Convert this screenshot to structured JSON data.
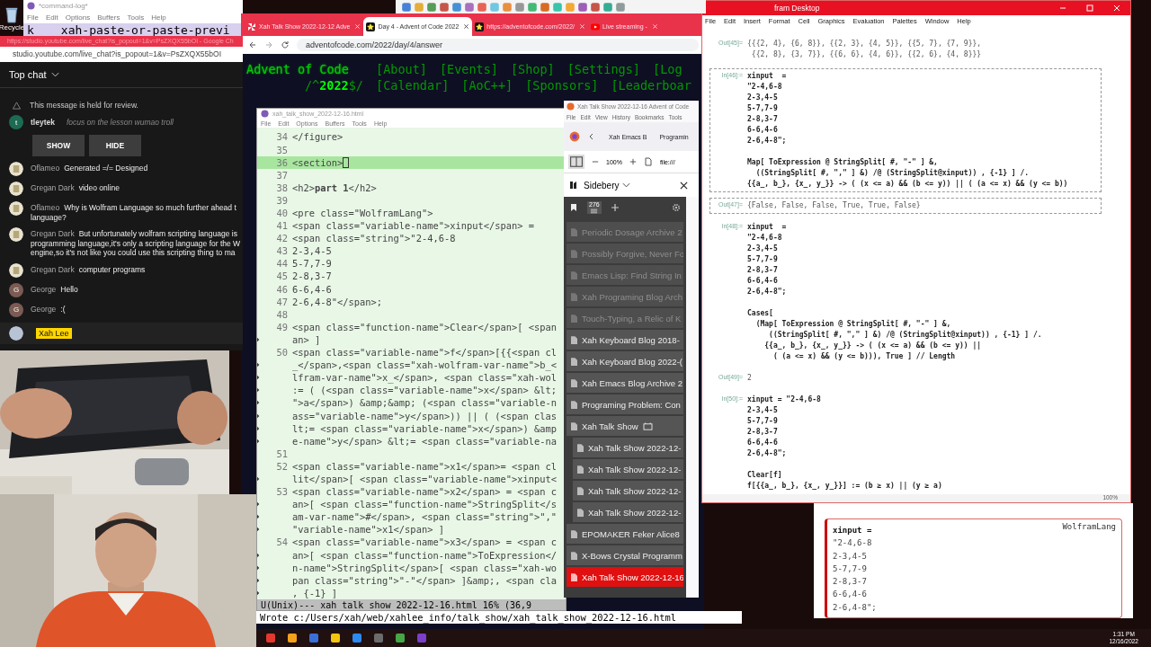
{
  "desktop": {
    "recycle_label": "Recycle"
  },
  "command_log": {
    "title": "*command-log*",
    "menu": [
      "File",
      "Edit",
      "Options",
      "Buffers",
      "Tools",
      "Help"
    ],
    "key": "k",
    "command": "xah-paste-or-paste-previ"
  },
  "chrome": {
    "tabs": [
      {
        "label": "Xah Talk Show 2022-12-12 Adve",
        "selected": false
      },
      {
        "label": "Day 4 - Advent of Code 2022",
        "selected": true
      },
      {
        "label": "https://adventofcode.com/2022/",
        "selected": false
      },
      {
        "label": "Live streaming - ",
        "selected": false
      }
    ],
    "url": "adventofcode.com/2022/day/4/answer",
    "site_title": "Advent of Code",
    "year_prefix": "/^",
    "year": "2022",
    "year_suffix": "$/",
    "nav_row_1": [
      "[About]",
      "[Events]",
      "[Shop]",
      "[Settings]",
      "[Log"
    ],
    "nav_row_2": [
      "[Calendar]",
      "[AoC++]",
      "[Sponsors]",
      "[Leaderboar"
    ]
  },
  "chat": {
    "window_title": "https://studio.youtube.com/live_chat?is_popout=1&v=PsZXQX55bOI - Google Ch",
    "url": "studio.youtube.com/live_chat?is_popout=1&v=PsZXQX55bOI",
    "header": "Top chat",
    "held": {
      "notice": "This message is held for review.",
      "author": "tleytek",
      "text": "focus on the lesson wumao troll",
      "avatar": {
        "kind": "letter",
        "letter": "t",
        "color": "#1d6b52"
      },
      "buttons": [
        "SHOW",
        "HIDE"
      ]
    },
    "messages": [
      {
        "author": "Oflameo",
        "text": "Generated =/= Designed"
      },
      {
        "author": "Gregan Dark",
        "text": "video online"
      },
      {
        "author": "Oflameo",
        "text": "Why is Wolfram Language so much further ahead t",
        "text_2": "language?"
      },
      {
        "author": "Gregan Dark",
        "text": "But unfortunately wolfram scripting language is",
        "text_2": "programming language,it's only a scripting language for the W",
        "text_3": "engine,so it's not like you could use this scripting thing to ma"
      },
      {
        "author": "Gregan Dark",
        "text": "computer programs"
      },
      {
        "author": "George",
        "text": "Hello",
        "avatar": {
          "kind": "letter",
          "letter": "G",
          "color": "#7b5b53"
        }
      },
      {
        "author": "George",
        "text": ":(",
        "avatar": {
          "kind": "letter",
          "letter": "G",
          "color": "#7b5b53"
        }
      }
    ],
    "own_author": "Xah Lee"
  },
  "emacs": {
    "title": "xah_talk_show_2022-12-16.html",
    "menu": [
      "File",
      "Edit",
      "Options",
      "Buffers",
      "Tools",
      "Help"
    ],
    "lines": [
      {
        "num": "34",
        "text": "</figure>",
        "current": false
      },
      {
        "num": "35",
        "current": false
      },
      {
        "num": "36",
        "text": "<section>",
        "current": true
      },
      {
        "num": "37",
        "current": false
      },
      {
        "num": "38",
        "text": "<h2>**part 1**</h2>",
        "current": false
      },
      {
        "num": "39",
        "current": false
      },
      {
        "num": "40",
        "text": "<pre class=\"WolframLang\">",
        "current": false
      },
      {
        "num": "41",
        "text": "<span class=\"variable-name\">xinput</span> =",
        "current": false
      },
      {
        "num": "42",
        "text": "<span class=\"string\">\"2-4,6-8",
        "current": false
      },
      {
        "num": "43",
        "text": "2-3,4-5",
        "current": false
      },
      {
        "num": "44",
        "text": "5-7,7-9",
        "current": false
      },
      {
        "num": "45",
        "text": "2-8,3-7",
        "current": false
      },
      {
        "num": "46",
        "text": "6-6,4-6",
        "current": false
      },
      {
        "num": "47",
        "text": "2-6,4-8\"</span>;",
        "current": false
      },
      {
        "num": "48",
        "current": false
      },
      {
        "num": "49",
        "text": "<span class=\"function-name\">Clear</span>[ <span",
        "current": false
      },
      {
        "text": "an> ]",
        "current": false
      },
      {
        "num": "50",
        "text": "<span class=\"variable-name\">f</span>[{{<span cl",
        "current": false
      },
      {
        "text": "_</span>,<span class=\"xah-wolfram-var-name\">b_<",
        "current": false
      },
      {
        "text": "lfram-var-name\">x_</span>, <span class=\"xah-wol",
        "current": false
      },
      {
        "text": ":= ( (<span class=\"variable-name\">x</span> &lt;",
        "current": false
      },
      {
        "text": "\">a</span>) &amp;&amp; (<span class=\"variable-n",
        "current": false
      },
      {
        "text": "ass=\"variable-name\">y</span>)) || ( (<span clas",
        "current": false
      },
      {
        "text": "lt;= <span class=\"variable-name\">x</span>) &amp",
        "current": false
      },
      {
        "text": "e-name\">y</span> &lt;= <span class=\"variable-na",
        "current": false
      },
      {
        "num": "51",
        "current": false
      },
      {
        "num": "52",
        "text": "<span class=\"variable-name\">x1</span>= <span cl",
        "current": false
      },
      {
        "text": "lit</span>[ <span class=\"variable-name\">xinput<",
        "current": false
      },
      {
        "num": "53",
        "text": "<span class=\"variable-name\">x2</span> = <span c",
        "current": false
      },
      {
        "text": "an>[ <span class=\"function-name\">StringSplit</s",
        "current": false
      },
      {
        "text": "am-var-name\">#</span>, <span class=\"string\">\",\"",
        "current": false
      },
      {
        "text": "\"variable-name\">x1</span> ]",
        "current": false
      },
      {
        "num": "54",
        "text": "<span class=\"variable-name\">x3</span> = <span c",
        "current": false
      },
      {
        "text": "an>[ <span class=\"function-name\">ToExpression</",
        "current": false
      },
      {
        "text": "n-name\">StringSplit</span>[ <span class=\"xah-wo",
        "current": false
      },
      {
        "text": "pan class=\"string\">\"-\"</span> ]&amp;, <span cla",
        "current": false
      },
      {
        "text": ", {-1} ]",
        "current": false
      }
    ],
    "mode_line": "U(Unix)--- xah_talk_show_2022-12-16.html 16% (36,9",
    "echo": "Wrote c:/Users/xah/web/xahlee_info/talk_show/xah_talk_show_2022-12-16.html"
  },
  "firefox": {
    "title": "Xah Talk Show 2022-12-16 Advent of Code",
    "menu": [
      "File",
      "Edit",
      "View",
      "History",
      "Bookmarks",
      "Tools"
    ],
    "tabs": [
      "Xah Emacs B",
      "Programin"
    ],
    "zoom": "100%",
    "url": "file:///",
    "sidebery": {
      "title": "Sidebery",
      "tab_count": "276",
      "items": [
        {
          "label": "Periodic Dosage Archive 2",
          "discarded": true,
          "selected": false
        },
        {
          "label": "Possibly Forgive, Never Fo",
          "discarded": true,
          "selected": false
        },
        {
          "label": "Emacs Lisp: Find String In",
          "discarded": true,
          "selected": false
        },
        {
          "label": "Xah Programing Blog Arch",
          "discarded": true,
          "selected": false
        },
        {
          "label": "Touch-Typing, a Relic of K",
          "discarded": true,
          "selected": false
        },
        {
          "label": "Xah Keyboard Blog 2018-",
          "discarded": false,
          "selected": false
        },
        {
          "label": "Xah Keyboard Blog 2022-(",
          "discarded": false,
          "selected": false
        },
        {
          "label": "Xah Emacs Blog Archive 2",
          "discarded": false,
          "selected": false
        },
        {
          "label": "Programing Problem: Con",
          "discarded": false,
          "selected": false
        },
        {
          "label": "Xah Talk Show",
          "discarded": false,
          "selected": false,
          "children": [
            {
              "label": "Xah Talk Show 2022-12-",
              "discarded": false,
              "selected": false
            },
            {
              "label": "Xah Talk Show 2022-12-",
              "discarded": false,
              "selected": false
            },
            {
              "label": "Xah Talk Show 2022-12-",
              "discarded": false,
              "selected": false
            },
            {
              "label": "Xah Talk Show 2022-12-",
              "discarded": false,
              "selected": false
            }
          ]
        },
        {
          "label": "EPOMAKER Feker Alice8",
          "discarded": false,
          "selected": false
        },
        {
          "label": "X-Bows Crystal Programm",
          "discarded": false,
          "selected": false
        },
        {
          "label": "Xah Talk Show 2022-12-16",
          "discarded": false,
          "selected": true
        }
      ]
    }
  },
  "mathematica": {
    "title": "fram Desktop",
    "menu": [
      "File",
      "Edit",
      "Insert",
      "Format",
      "Cell",
      "Graphics",
      "Evaluation",
      "Palettes",
      "Window",
      "Help"
    ],
    "zoom": "100%",
    "cells": [
      {
        "label": "Out[45]=",
        "kind": "output",
        "blocks": [
          [
            "{{{2, 4}, {6, 8}}, {{2, 3}, {4, 5}}, {{5, 7}, {7, 9}},",
            " {{2, 8}, {3, 7}}, {{6, 6}, {4, 6}}, {{2, 6}, {4, 8}}}"
          ]
        ],
        "selected": false
      },
      {
        "label": "In[46]:=",
        "kind": "input",
        "selected": true,
        "blocks": [
          [
            "xinput  =",
            "\"2-4,6-8",
            "2-3,4-5",
            "5-7,7-9",
            "2-8,3-7",
            "6-6,4-6",
            "2-6,4-8\";"
          ],
          [
            "Map[ ToExpression @ StringSplit[ #, \"-\" ] &,",
            "  ((StringSplit[ #, \",\" ] &) /@ (StringSplit@xinput)) , {-1} ] /.",
            "{{a_, b_}, {x_, y_}} -> ( (x <= a) && (b <= y)) || ( (a <= x) && (y <= b))"
          ]
        ]
      },
      {
        "label": "Out[47]=",
        "kind": "output",
        "selected": true,
        "blocks": [
          [
            "{False, False, False, True, True, False}"
          ]
        ]
      },
      {
        "label": "In[48]:=",
        "kind": "input",
        "selected": false,
        "blocks": [
          [
            "xinput  =",
            "\"2-4,6-8",
            "2-3,4-5",
            "5-7,7-9",
            "2-8,3-7",
            "6-6,4-6",
            "2-6,4-8\";"
          ],
          [
            "Cases[",
            "  (Map[ ToExpression @ StringSplit[ #, \"-\" ] &,",
            "     ((StringSplit[ #, \",\" ] &) /@ (StringSplit@xinput)) , {-1} ] /.",
            "    {{a_, b_}, {x_, y_}} -> ( (x <= a) && (b <= y)) ||",
            "      ( (a <= x) && (y <= b))), True ] // Length"
          ]
        ]
      },
      {
        "label": "Out[49]=",
        "kind": "output",
        "selected": false,
        "blocks": [
          [
            "2"
          ]
        ]
      },
      {
        "label": "In[50]:=",
        "kind": "input",
        "selected": false,
        "blocks": [
          [
            "xinput = \"2-4,6-8",
            "2-3,4-5",
            "5-7,7-9",
            "2-8,3-7",
            "6-6,4-6",
            "2-6,4-8\";"
          ],
          [
            "Clear[f]",
            "f[{{a_, b_}, {x_, y_}}] := (b ≥ x) || (y ≥ a)"
          ]
        ]
      }
    ]
  },
  "web_page": {
    "code_label": "WolframLang",
    "code_lines": [
      "xinput =",
      "\"2-4,6-8",
      "2-3,4-5",
      "5-7,7-9",
      "2-8,3-7",
      "6-6,4-6",
      "2-6,4-8\";"
    ]
  },
  "taskbar": {
    "time": "1:31 PM",
    "date": "12/16/2022"
  }
}
